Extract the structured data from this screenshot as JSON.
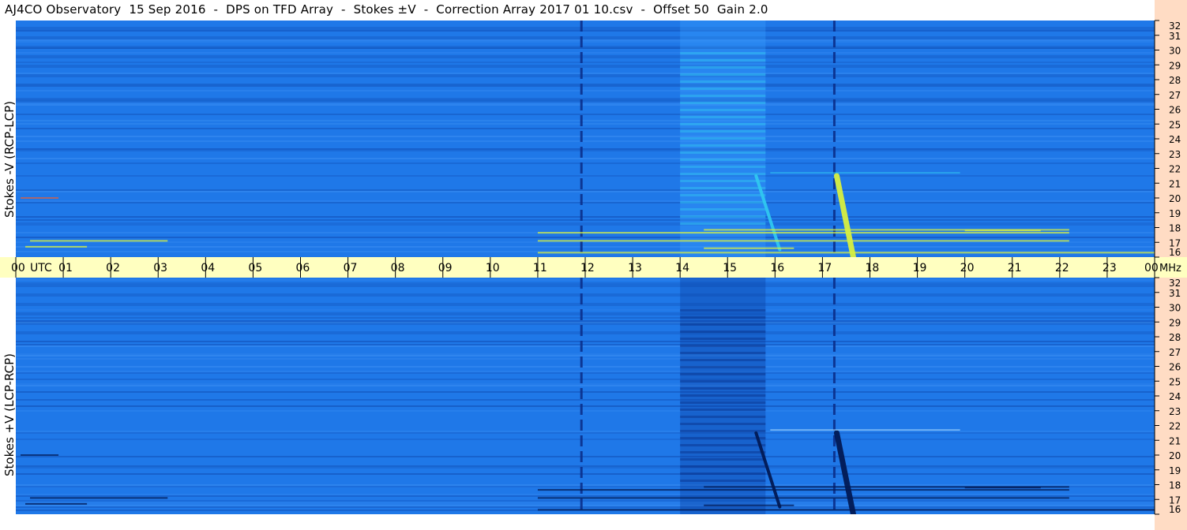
{
  "title": "AJ4CO Observatory  15 Sep 2016  -  DPS on TFD Array  -  Stokes ±V  -  Correction Array 2017 01 10.csv  -  Offset 50  Gain 2.0",
  "chart_data": [
    {
      "type": "heatmap",
      "panel": "top",
      "ylabel": "Stokes -V (RCP-LCP)",
      "x_label_utc": "UTC",
      "x_ticks": [
        "00",
        "01",
        "02",
        "03",
        "04",
        "05",
        "06",
        "07",
        "08",
        "09",
        "10",
        "11",
        "12",
        "13",
        "14",
        "15",
        "16",
        "17",
        "18",
        "19",
        "20",
        "21",
        "22",
        "23",
        "00"
      ],
      "x_range_hours": [
        0,
        24
      ],
      "y_unit": "MHz",
      "y_ticks": [
        16,
        17,
        18,
        19,
        20,
        21,
        22,
        23,
        24,
        25,
        26,
        27,
        28,
        29,
        30,
        31,
        32
      ],
      "y_range_mhz": [
        16,
        32
      ],
      "features": [
        {
          "kind": "broadband_vertical_line",
          "time_utc": 11.92
        },
        {
          "kind": "broadband_vertical_line",
          "time_utc": 17.25
        },
        {
          "kind": "emission_band",
          "time_utc_start": 14.0,
          "time_utc_end": 15.8
        },
        {
          "kind": "drifting_burst",
          "time_utc_start": 17.3,
          "time_utc_end": 17.65,
          "freq_mhz_start": 21.5,
          "freq_mhz_end": 16.0,
          "polarity": "positive"
        },
        {
          "kind": "drifting_burst",
          "time_utc_start": 15.6,
          "time_utc_end": 16.1,
          "freq_mhz_start": 21.5,
          "freq_mhz_end": 16.5,
          "polarity": "positive"
        }
      ]
    },
    {
      "type": "heatmap",
      "panel": "bottom",
      "ylabel": "Stokes +V (LCP-RCP)",
      "y_unit": "MHz",
      "y_ticks": [
        16,
        17,
        18,
        19,
        20,
        21,
        22,
        23,
        24,
        25,
        26,
        27,
        28,
        29,
        30,
        31,
        32
      ],
      "y_range_mhz": [
        16,
        32
      ],
      "x_range_hours": [
        0,
        24
      ],
      "features": [
        {
          "kind": "broadband_vertical_line",
          "time_utc": 11.92
        },
        {
          "kind": "broadband_vertical_line",
          "time_utc": 17.25
        },
        {
          "kind": "emission_band",
          "time_utc_start": 14.0,
          "time_utc_end": 15.8
        },
        {
          "kind": "drifting_burst",
          "time_utc_start": 17.3,
          "time_utc_end": 17.65,
          "freq_mhz_start": 21.5,
          "freq_mhz_end": 16.0,
          "polarity": "negative"
        },
        {
          "kind": "drifting_burst",
          "time_utc_start": 15.6,
          "time_utc_end": 16.1,
          "freq_mhz_start": 21.5,
          "freq_mhz_end": 16.5,
          "polarity": "negative"
        }
      ]
    }
  ],
  "colors": {
    "background_blue": "#1f78e8",
    "dark_blue": "#0a3a9c",
    "cyan": "#30c8f0",
    "yellow_green": "#d8f040",
    "utc_bar": "#ffffc0",
    "freq_bar": "#ffdcc4"
  }
}
